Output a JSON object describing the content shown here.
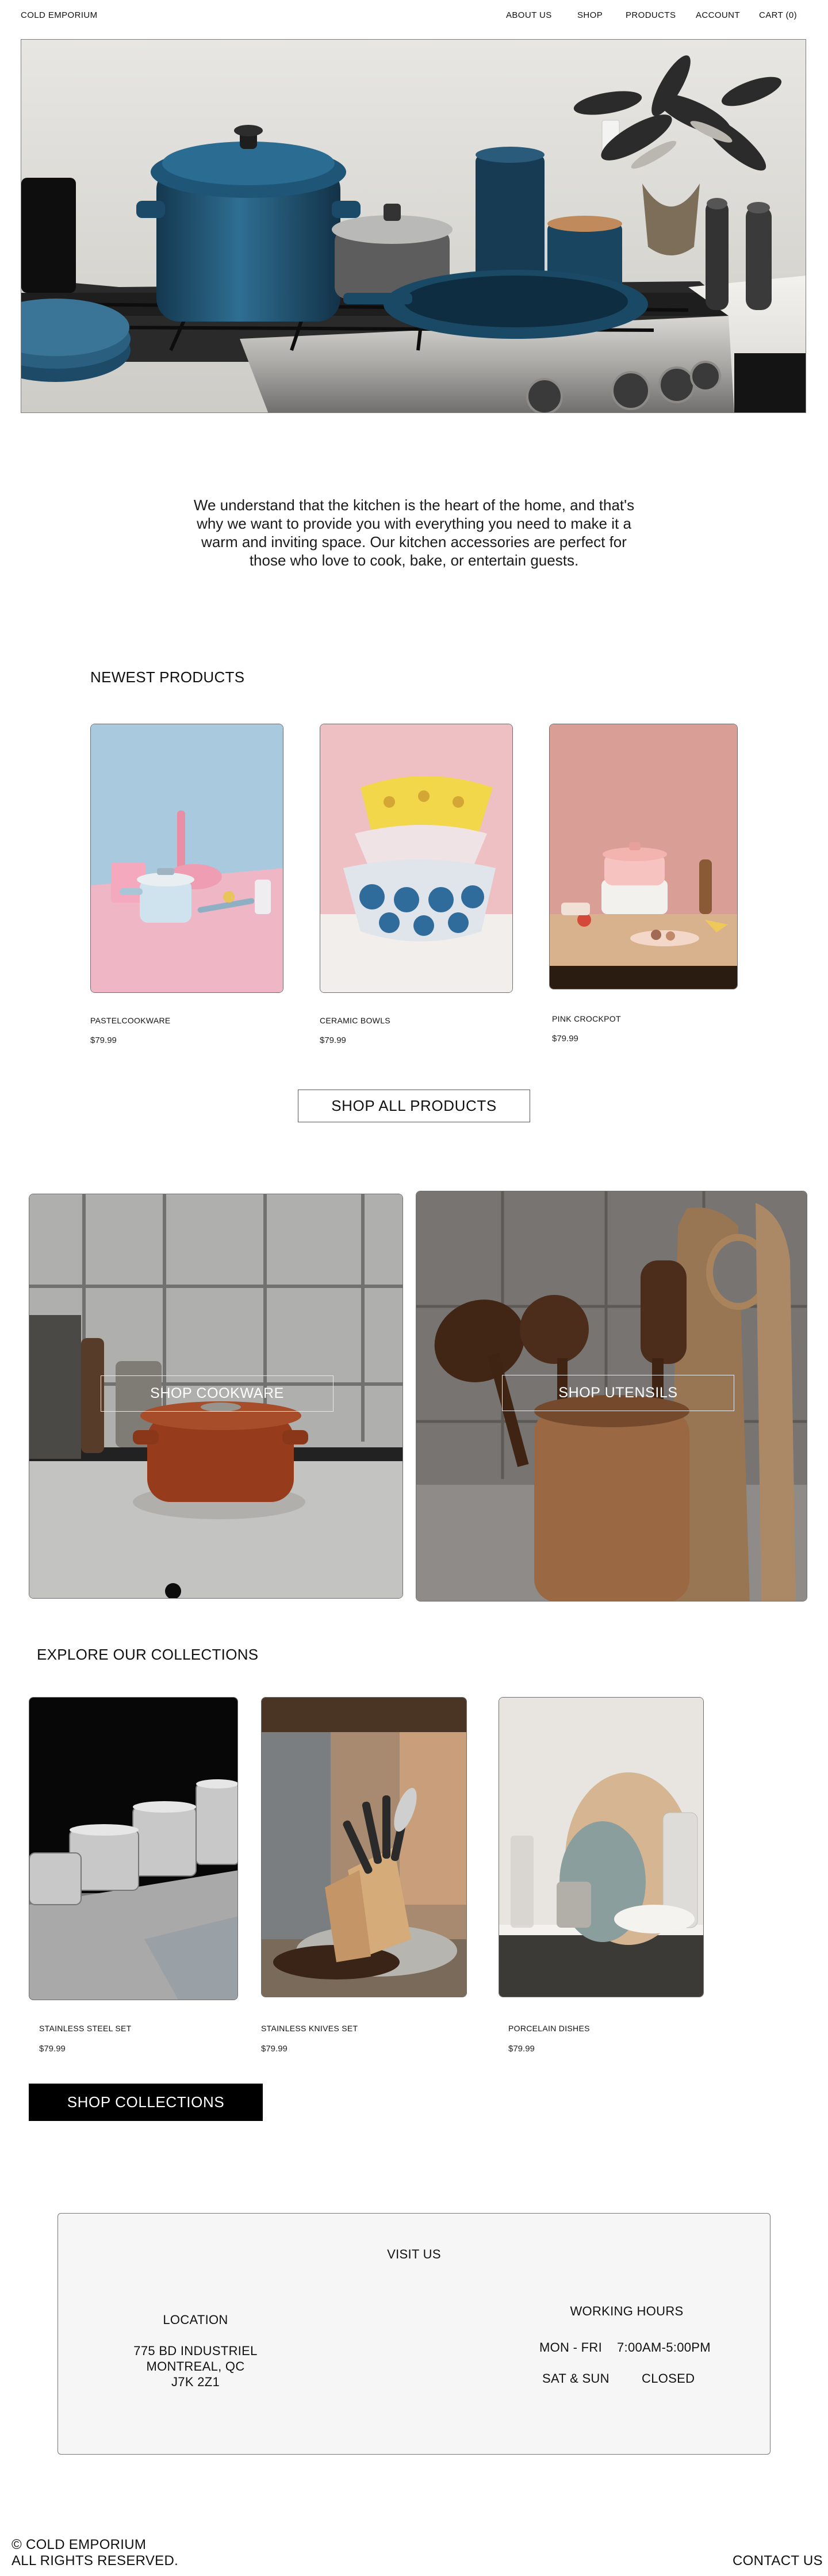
{
  "header": {
    "brand": "COLD EMPORIUM",
    "nav": [
      "ABOUT US",
      "SHOP",
      "PRODUCTS",
      "ACCOUNT",
      "CART (0)"
    ]
  },
  "intro": {
    "text": "We understand that the kitchen is the heart of the home, and that's why we want to provide you with everything you need to make it a warm and inviting space. Our kitchen accessories are perfect for those who love to cook, bake, or entertain guests."
  },
  "newest": {
    "title": "NEWEST PRODUCTS",
    "products": [
      {
        "name": "PASTELCOOKWARE",
        "price": "$79.99"
      },
      {
        "name": "CERAMIC BOWLS",
        "price": "$79.99"
      },
      {
        "name": "PINK CROCKPOT",
        "price": "$79.99"
      }
    ],
    "cta": "SHOP ALL PRODUCTS"
  },
  "categories": {
    "cookware": "SHOP COOKWARE",
    "utensils": "SHOP UTENSILS"
  },
  "collections": {
    "title": "EXPLORE OUR COLLECTIONS",
    "items": [
      {
        "name": "STAINLESS STEEL SET",
        "price": "$79.99"
      },
      {
        "name": "STAINLESS KNIVES SET",
        "price": "$79.99"
      },
      {
        "name": "PORCELAIN DISHES",
        "price": "$79.99"
      }
    ],
    "cta": "SHOP COLLECTIONS"
  },
  "visit": {
    "title": "VISIT US",
    "location_title": "LOCATION",
    "address": [
      "775 BD INDUSTRIEL",
      "MONTREAL, QC",
      "J7K 2Z1"
    ],
    "hours_title": "WORKING HOURS",
    "hours": [
      {
        "days": "MON - FRI",
        "time": "7:00AM-5:00PM"
      },
      {
        "days": "SAT & SUN",
        "time": "CLOSED"
      }
    ]
  },
  "footer": {
    "copyright": "© COLD EMPORIUM",
    "rights": "ALL RIGHTS RESERVED.",
    "contact": "CONTACT US"
  }
}
